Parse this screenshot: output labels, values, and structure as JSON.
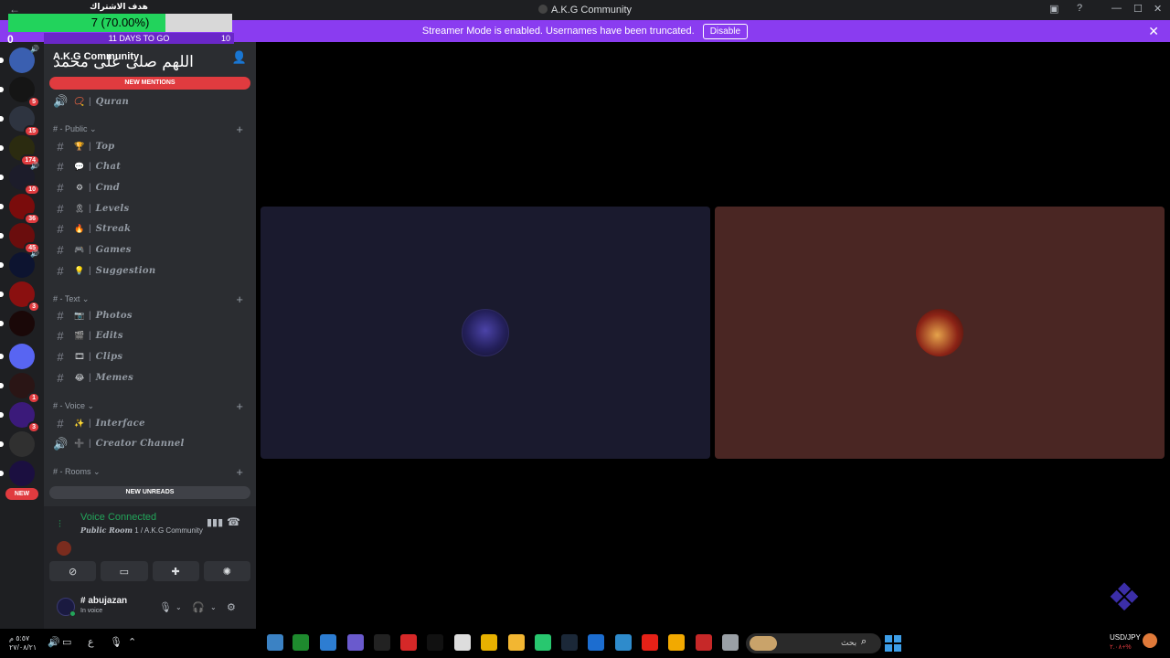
{
  "window": {
    "title": "A.K.G Community",
    "back_glyph": "←",
    "controls": [
      "▣",
      "?",
      "—",
      "☐",
      "✕"
    ]
  },
  "banner": {
    "text": "Streamer Mode is enabled. Usernames have been truncated.",
    "disable_label": "Disable",
    "close_glyph": "✕"
  },
  "goal_overlay": {
    "title": "هدف الاشتراك",
    "progress_text": "7 (70.00%)",
    "progress_fraction": 0.7,
    "start_count": "0",
    "days_left": "11 DAYS TO GO",
    "target_count": "10"
  },
  "rail": {
    "servers": [
      {
        "color": "#3a5fb0",
        "badge": "",
        "voice": true
      },
      {
        "color": "#151515",
        "badge": "5",
        "voice": false
      },
      {
        "color": "#2e3440",
        "badge": "15",
        "voice": false
      },
      {
        "color": "#2b2b10",
        "badge": "174",
        "voice": false
      },
      {
        "color": "#1c1c2a",
        "badge": "10",
        "voice": true
      },
      {
        "color": "#7a0c0c",
        "badge": "36",
        "voice": false
      },
      {
        "color": "#6a0d0d",
        "badge": "45",
        "voice": false
      },
      {
        "color": "#0d1430",
        "badge": "",
        "voice": true
      },
      {
        "color": "#8a1010",
        "badge": "3",
        "voice": false
      },
      {
        "color": "#1a0808",
        "badge": "",
        "voice": false
      },
      {
        "color": "#5865f2",
        "badge": "",
        "voice": false
      },
      {
        "color": "#2a1515",
        "badge": "1",
        "voice": false
      },
      {
        "color": "#3b1a7a",
        "badge": "3",
        "voice": false
      },
      {
        "color": "#303030",
        "badge": "",
        "voice": false
      },
      {
        "color": "#1b0f40",
        "badge": "",
        "voice": false
      }
    ],
    "new_label": "NEW"
  },
  "sidebar": {
    "server_name": "A.K.G Community",
    "server_arabic": "اللهم صلى على محمد",
    "invite_glyph": "👤",
    "new_mentions": "NEW MENTIONS",
    "new_unreads": "NEW UNREADS",
    "top_channel": {
      "type": "voice",
      "emoji": "📿",
      "label": "Quran"
    },
    "categories": [
      {
        "name": "# - Public ⌄",
        "channels": [
          {
            "type": "text",
            "emoji": "🏆",
            "label": "Top"
          },
          {
            "type": "text",
            "emoji": "💬",
            "label": "Chat"
          },
          {
            "type": "text",
            "emoji": "⚙",
            "label": "Cmd"
          },
          {
            "type": "text",
            "emoji": "🎗",
            "label": "Levels"
          },
          {
            "type": "text",
            "emoji": "🔥",
            "label": "Streak"
          },
          {
            "type": "text",
            "emoji": "🎮",
            "label": "Games"
          },
          {
            "type": "text",
            "emoji": "💡",
            "label": "Suggestion"
          }
        ]
      },
      {
        "name": "# - Text ⌄",
        "channels": [
          {
            "type": "text",
            "emoji": "📷",
            "label": "Photos"
          },
          {
            "type": "text",
            "emoji": "🎬",
            "label": "Edits"
          },
          {
            "type": "text",
            "emoji": "🎞",
            "label": "Clips"
          },
          {
            "type": "text",
            "emoji": "😂",
            "label": "Memes"
          }
        ]
      },
      {
        "name": "# - Voice ⌄",
        "channels": [
          {
            "type": "text",
            "emoji": "✨",
            "label": "Interface"
          },
          {
            "type": "voice",
            "emoji": "➕",
            "label": "Creator Channel"
          }
        ]
      },
      {
        "name": "# - Rooms ⌄",
        "channels": []
      }
    ]
  },
  "voice_panel": {
    "status": "Voice Connected",
    "room": "Public Room",
    "room_suffix": "1 / A.K.G Community"
  },
  "user_panel": {
    "username": "# abujazan",
    "status": "In voice"
  },
  "taskbar": {
    "date_line1": "٥:٥٧ م",
    "date_line2": "٢٧/٠٨/٢١",
    "lang": "ع",
    "search_placeholder": "بحث",
    "ticker": "USD/JPY",
    "ticker_change": "٢.٠٨+%"
  }
}
